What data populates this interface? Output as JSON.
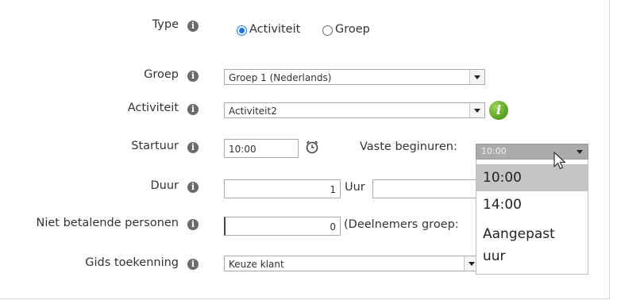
{
  "form": {
    "type": {
      "label": "Type",
      "options": [
        {
          "label": "Activiteit",
          "checked": true
        },
        {
          "label": "Groep",
          "checked": false
        }
      ]
    },
    "groep": {
      "label": "Groep",
      "value": "Groep 1 (Nederlands)"
    },
    "activiteit": {
      "label": "Activiteit",
      "value": "Activiteit2"
    },
    "startuur": {
      "label": "Startuur",
      "value": "10:00"
    },
    "vaste_beginuren": {
      "label": "Vaste beginuren:",
      "value": "10:00",
      "options": [
        "10:00",
        "14:00",
        "Aangepast uur"
      ],
      "selected_index": 0
    },
    "duur": {
      "label": "Duur",
      "value": "1",
      "unit_label": "Uur"
    },
    "niet_betalende": {
      "label": "Niet betalende personen",
      "value": "0",
      "suffix": "(Deelnemers groep:"
    },
    "gids": {
      "label": "Gids toekenning",
      "value": "Keuze klant"
    }
  },
  "icons": {
    "info": "info-icon",
    "alarm": "alarm-clock-icon",
    "green_info": "green-info-icon",
    "cursor": "mouse-cursor-icon"
  },
  "colors": {
    "radio_accent": "#1a73e8",
    "green_info": "#55a01a",
    "dropdown_selected": "#c4c4c4"
  }
}
